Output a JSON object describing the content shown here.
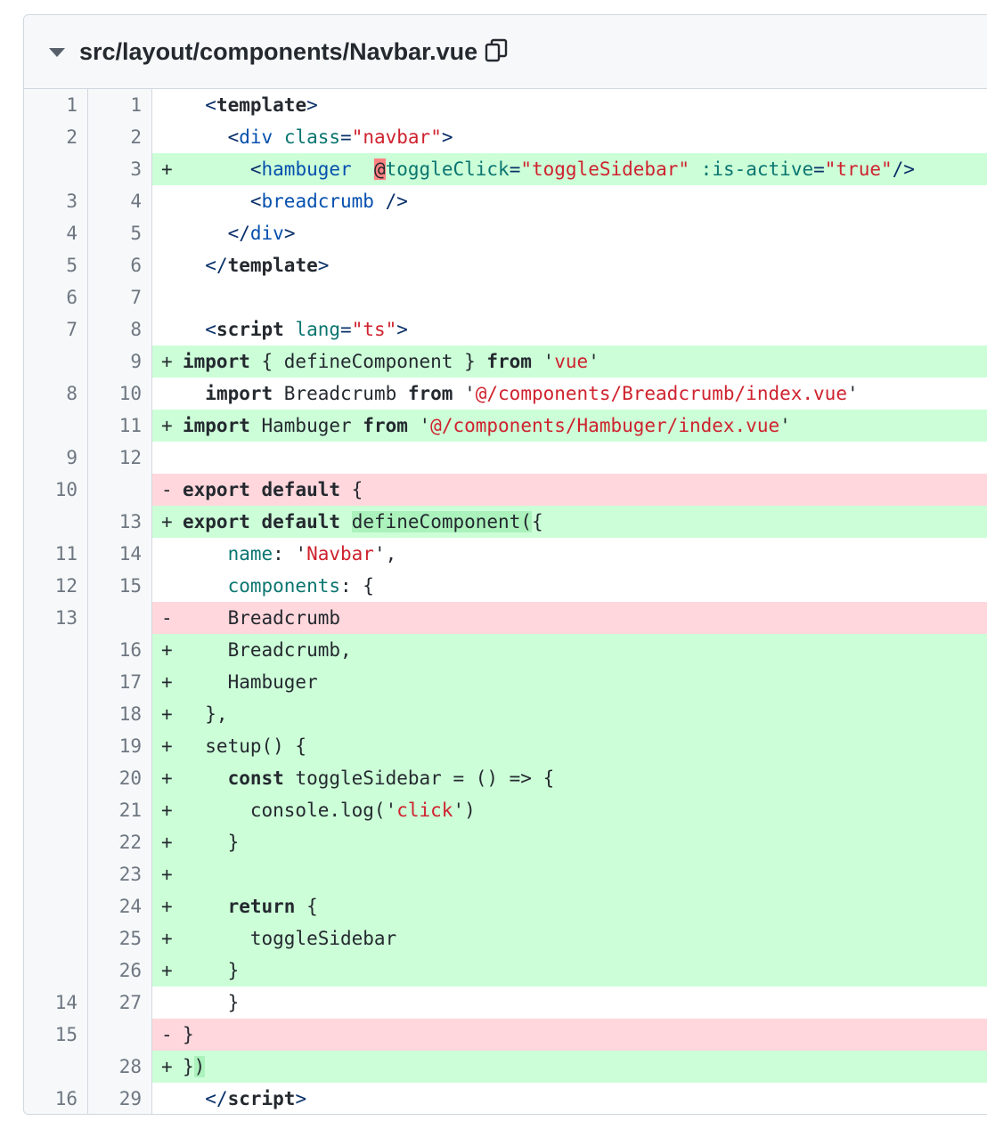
{
  "file": {
    "path": "src/layout/components/Navbar.vue",
    "toggle_icon": "triangle-down-icon",
    "copy_icon": "copy-icon"
  },
  "colors": {
    "addition_bg": "#ccffd8",
    "deletion_bg": "#ffd7dc",
    "gutter_bg": "#f6f8fa"
  },
  "lines": [
    {
      "old": "1",
      "new": "1",
      "type": "ctx",
      "tokens": [
        [
          "p",
          "  "
        ],
        [
          "tag",
          "<"
        ],
        [
          "tn",
          "template"
        ],
        [
          "tag",
          ">"
        ]
      ]
    },
    {
      "old": "2",
      "new": "2",
      "type": "ctx",
      "tokens": [
        [
          "p",
          "    "
        ],
        [
          "tag",
          "<"
        ],
        [
          "tag-d",
          "div"
        ],
        [
          "p",
          " "
        ],
        [
          "attr-t",
          "class"
        ],
        [
          "tag",
          "="
        ],
        [
          "str",
          "\"navbar\""
        ],
        [
          "tag",
          ">"
        ]
      ]
    },
    {
      "old": "",
      "new": "3",
      "type": "add",
      "tokens": [
        [
          "p",
          "      "
        ],
        [
          "tag",
          "<"
        ],
        [
          "tag-d",
          "hambuger"
        ],
        [
          "p",
          "  "
        ],
        [
          "hl-at",
          "@"
        ],
        [
          "attr-t",
          "toggleClick"
        ],
        [
          "tag",
          "="
        ],
        [
          "str",
          "\"toggleSidebar\""
        ],
        [
          "p",
          " "
        ],
        [
          "attr-t",
          ":is-active"
        ],
        [
          "tag",
          "="
        ],
        [
          "str",
          "\"true\""
        ],
        [
          "tag",
          "/>"
        ]
      ]
    },
    {
      "old": "3",
      "new": "4",
      "type": "ctx",
      "tokens": [
        [
          "p",
          "      "
        ],
        [
          "tag",
          "<"
        ],
        [
          "tag-d",
          "breadcrumb"
        ],
        [
          "p",
          " "
        ],
        [
          "tag",
          "/>"
        ]
      ]
    },
    {
      "old": "4",
      "new": "5",
      "type": "ctx",
      "tokens": [
        [
          "p",
          "    "
        ],
        [
          "tag",
          "</"
        ],
        [
          "tag-d",
          "div"
        ],
        [
          "tag",
          ">"
        ]
      ]
    },
    {
      "old": "5",
      "new": "6",
      "type": "ctx",
      "tokens": [
        [
          "p",
          "  "
        ],
        [
          "tag",
          "</"
        ],
        [
          "tn",
          "template"
        ],
        [
          "tag",
          ">"
        ]
      ]
    },
    {
      "old": "6",
      "new": "7",
      "type": "ctx",
      "tokens": [
        [
          "p",
          " "
        ]
      ]
    },
    {
      "old": "7",
      "new": "8",
      "type": "ctx",
      "tokens": [
        [
          "p",
          "  "
        ],
        [
          "tag",
          "<"
        ],
        [
          "tn",
          "script"
        ],
        [
          "p",
          " "
        ],
        [
          "attr-t",
          "lang"
        ],
        [
          "tag",
          "="
        ],
        [
          "str",
          "\"ts\""
        ],
        [
          "tag",
          ">"
        ]
      ]
    },
    {
      "old": "",
      "new": "9",
      "type": "add",
      "tokens": [
        [
          "k",
          "import"
        ],
        [
          "p",
          " { defineComponent } "
        ],
        [
          "k",
          "from"
        ],
        [
          "p",
          " '"
        ],
        [
          "str",
          "vue"
        ],
        [
          "p",
          "'"
        ]
      ]
    },
    {
      "old": "8",
      "new": "10",
      "type": "ctx",
      "tokens": [
        [
          "p",
          "  "
        ],
        [
          "k",
          "import"
        ],
        [
          "p",
          " Breadcrumb "
        ],
        [
          "k",
          "from"
        ],
        [
          "p",
          " '"
        ],
        [
          "str",
          "@/components/Breadcrumb/index.vue"
        ],
        [
          "p",
          "'"
        ]
      ]
    },
    {
      "old": "",
      "new": "11",
      "type": "add",
      "tokens": [
        [
          "k",
          "import"
        ],
        [
          "p",
          " Hambuger "
        ],
        [
          "k",
          "from"
        ],
        [
          "p",
          " '"
        ],
        [
          "str",
          "@/components/Hambuger/index.vue"
        ],
        [
          "p",
          "'"
        ]
      ]
    },
    {
      "old": "9",
      "new": "12",
      "type": "ctx",
      "tokens": [
        [
          "p",
          " "
        ]
      ]
    },
    {
      "old": "10",
      "new": "",
      "type": "del",
      "tokens": [
        [
          "k",
          "export"
        ],
        [
          "p",
          " "
        ],
        [
          "k",
          "default"
        ],
        [
          "p",
          " {"
        ]
      ]
    },
    {
      "old": "",
      "new": "13",
      "type": "add",
      "tokens": [
        [
          "k",
          "export"
        ],
        [
          "p",
          " "
        ],
        [
          "k",
          "default"
        ],
        [
          "p",
          " "
        ],
        [
          "hl-add",
          "defineComponent("
        ],
        [
          "p",
          "{"
        ]
      ]
    },
    {
      "old": "11",
      "new": "14",
      "type": "ctx",
      "tokens": [
        [
          "p",
          "    "
        ],
        [
          "attr-t",
          "name"
        ],
        [
          "p",
          ": '"
        ],
        [
          "str",
          "Navbar"
        ],
        [
          "p",
          "',"
        ]
      ]
    },
    {
      "old": "12",
      "new": "15",
      "type": "ctx",
      "tokens": [
        [
          "p",
          "    "
        ],
        [
          "attr-t",
          "components"
        ],
        [
          "p",
          ": {"
        ]
      ]
    },
    {
      "old": "13",
      "new": "",
      "type": "del",
      "tokens": [
        [
          "p",
          "    Breadcrumb"
        ]
      ]
    },
    {
      "old": "",
      "new": "16",
      "type": "add",
      "tokens": [
        [
          "p",
          "    Breadcrumb,"
        ]
      ]
    },
    {
      "old": "",
      "new": "17",
      "type": "add",
      "tokens": [
        [
          "p",
          "    Hambuger"
        ]
      ]
    },
    {
      "old": "",
      "new": "18",
      "type": "add",
      "tokens": [
        [
          "p",
          "  },"
        ]
      ]
    },
    {
      "old": "",
      "new": "19",
      "type": "add",
      "tokens": [
        [
          "p",
          "  setup() {"
        ]
      ]
    },
    {
      "old": "",
      "new": "20",
      "type": "add",
      "tokens": [
        [
          "p",
          "    "
        ],
        [
          "k",
          "const"
        ],
        [
          "p",
          " toggleSidebar = () => {"
        ]
      ]
    },
    {
      "old": "",
      "new": "21",
      "type": "add",
      "tokens": [
        [
          "p",
          "      console.log('"
        ],
        [
          "str",
          "click"
        ],
        [
          "p",
          "')"
        ]
      ]
    },
    {
      "old": "",
      "new": "22",
      "type": "add",
      "tokens": [
        [
          "p",
          "    }"
        ]
      ]
    },
    {
      "old": "",
      "new": "23",
      "type": "add",
      "tokens": [
        [
          "p",
          ""
        ]
      ]
    },
    {
      "old": "",
      "new": "24",
      "type": "add",
      "tokens": [
        [
          "p",
          "    "
        ],
        [
          "k",
          "return"
        ],
        [
          "p",
          " {"
        ]
      ]
    },
    {
      "old": "",
      "new": "25",
      "type": "add",
      "tokens": [
        [
          "p",
          "      toggleSidebar"
        ]
      ]
    },
    {
      "old": "",
      "new": "26",
      "type": "add",
      "tokens": [
        [
          "p",
          "    }"
        ]
      ]
    },
    {
      "old": "14",
      "new": "27",
      "type": "ctx",
      "tokens": [
        [
          "p",
          "    }"
        ]
      ]
    },
    {
      "old": "15",
      "new": "",
      "type": "del",
      "tokens": [
        [
          "p",
          "}"
        ]
      ]
    },
    {
      "old": "",
      "new": "28",
      "type": "add",
      "tokens": [
        [
          "p",
          "}"
        ],
        [
          "hl-add",
          ")"
        ]
      ]
    },
    {
      "old": "16",
      "new": "29",
      "type": "ctx",
      "tokens": [
        [
          "p",
          "  "
        ],
        [
          "tag",
          "</"
        ],
        [
          "tn",
          "script"
        ],
        [
          "tag",
          ">"
        ]
      ]
    }
  ]
}
